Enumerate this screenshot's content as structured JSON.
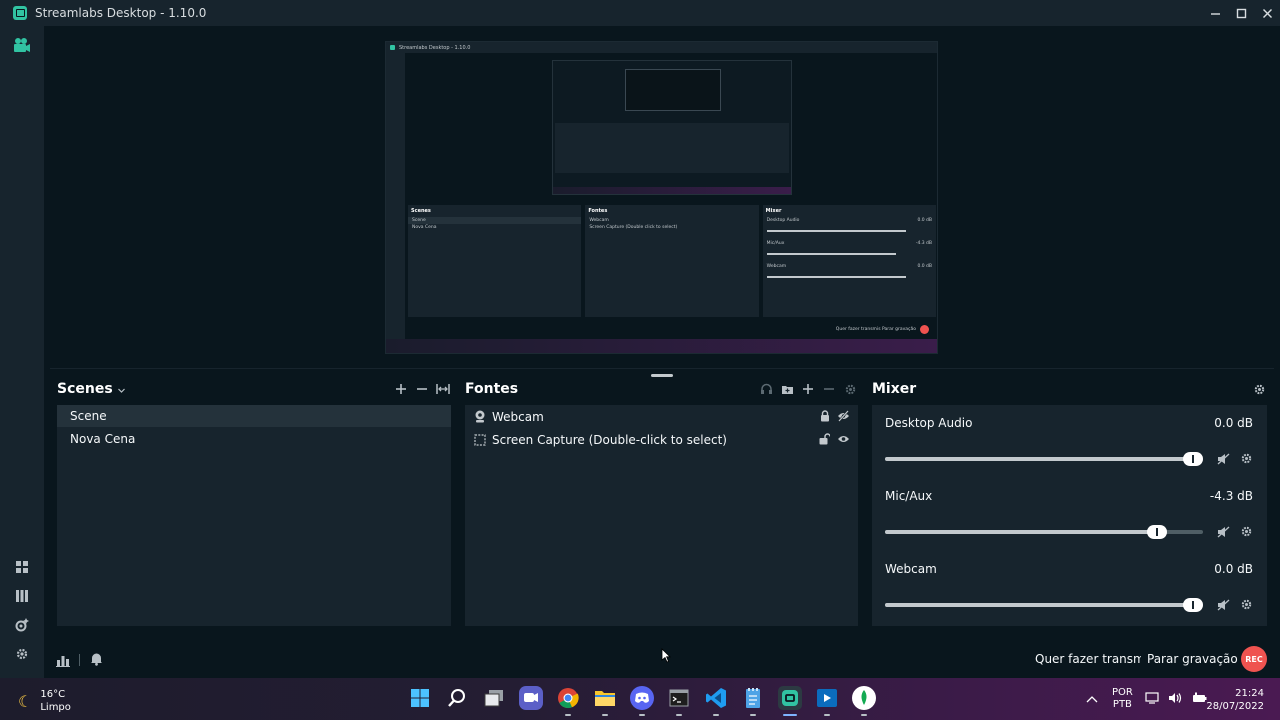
{
  "window": {
    "title": "Streamlabs Desktop - 1.10.0",
    "minimize_icon": "minimize-icon",
    "maximize_icon": "maximize-icon",
    "close_icon": "close-icon"
  },
  "preview": {
    "mini_title": "Streamlabs Desktop - 1.10.0",
    "mini_scenes_title": "Scenes",
    "mini_scenes": [
      "Scene",
      "Nova Cena"
    ],
    "mini_sources_title": "Fontes",
    "mini_sources": [
      "Webcam",
      "Screen Capture (Double click to select)"
    ],
    "mini_mixer_title": "Mixer",
    "mini_mixer": [
      {
        "name": "Desktop Audio",
        "db": "0.0 dB"
      },
      {
        "name": "Mic/Aux",
        "db": "-4.3 dB"
      },
      {
        "name": "Webcam",
        "db": "0.0 dB"
      }
    ],
    "mini_footer": "Quer fazer transmis  Parar gravação"
  },
  "scenes": {
    "title": "Scenes",
    "items": [
      {
        "label": "Scene",
        "active": true
      },
      {
        "label": "Nova Cena",
        "active": false
      }
    ]
  },
  "sources": {
    "title": "Fontes",
    "items": [
      {
        "label": "Webcam",
        "icon": "webcam-icon"
      },
      {
        "label": "Screen Capture (Double-click to select)",
        "icon": "screen-capture-icon"
      }
    ]
  },
  "mixer": {
    "title": "Mixer",
    "items": [
      {
        "name": "Desktop Audio",
        "db": "0.0 dB",
        "level": 1.0
      },
      {
        "name": "Mic/Aux",
        "db": "-4.3 dB",
        "level": 0.88
      },
      {
        "name": "Webcam",
        "db": "0.0 dB",
        "level": 1.0
      }
    ]
  },
  "footer": {
    "go_live": "Quer fazer transmissão",
    "stop_recording": "Parar gravação",
    "rec_badge": "REC"
  },
  "taskbar": {
    "weather_temp": "16°C",
    "weather_desc": "Limpo",
    "lang_top": "POR",
    "lang_bottom": "PTB",
    "time": "21:24",
    "date": "28/07/2022",
    "apps": [
      "windows-start-icon",
      "search-icon",
      "task-view-icon",
      "teams-chat-icon",
      "chrome-icon",
      "file-explorer-icon",
      "discord-icon",
      "terminal-icon",
      "vscode-icon",
      "notepad-icon",
      "streamlabs-icon",
      "media-player-icon",
      "mongodb-compass-icon"
    ]
  },
  "colors": {
    "accent": "#31c3a2",
    "panel": "#17242d",
    "background": "#09161d",
    "rec": "#ef5350"
  }
}
